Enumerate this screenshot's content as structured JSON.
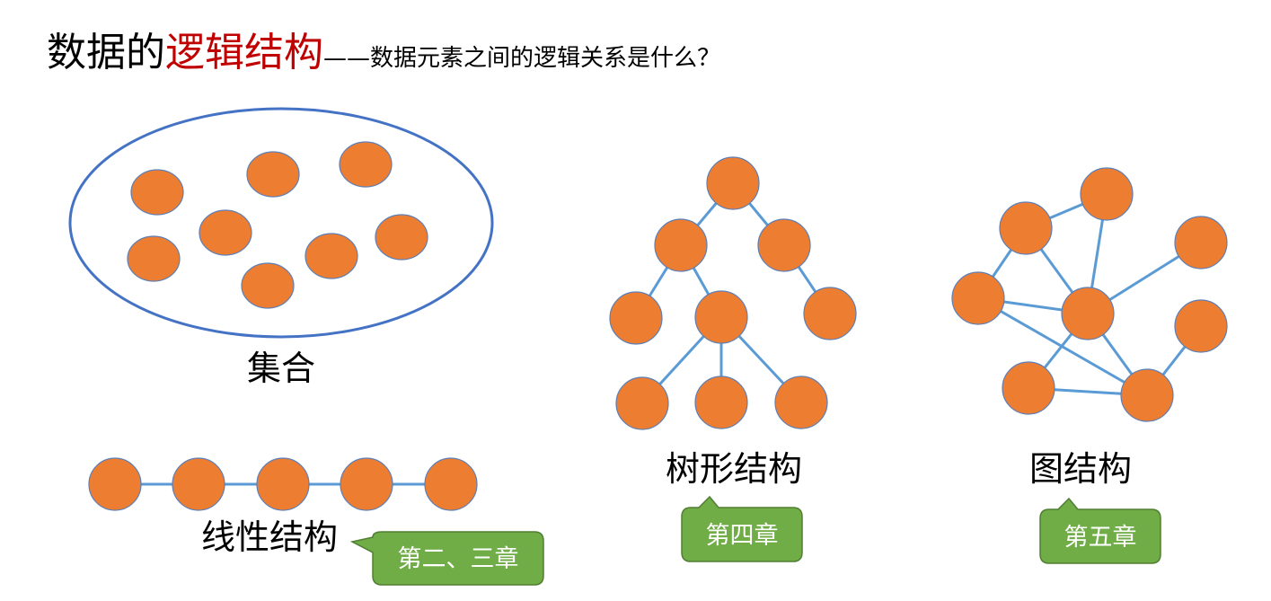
{
  "title": {
    "part1": "数据的",
    "part2": "逻辑结构",
    "subtitle": "——数据元素之间的逻辑关系是什么？"
  },
  "structures": {
    "set": {
      "label": "集合"
    },
    "linear": {
      "label": "线性结构",
      "chapter": "第二、三章"
    },
    "tree": {
      "label": "树形结构",
      "chapter": "第四章"
    },
    "graph": {
      "label": "图结构",
      "chapter": "第五章"
    }
  },
  "colors": {
    "node": "#ed7d31",
    "node_border": "#5b7fb8",
    "edge": "#5b9bd5",
    "ellipse": "#4472c4",
    "callout": "#70ad47",
    "accent": "#c00000"
  }
}
